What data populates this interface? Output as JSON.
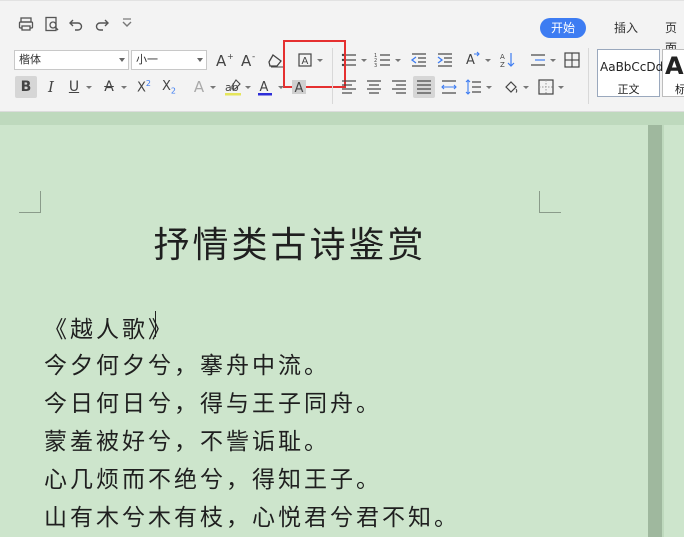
{
  "ribbon": {
    "tabs": [
      {
        "label": "开始",
        "active": true
      },
      {
        "label": "插入",
        "active": false
      },
      {
        "label": "页面"
      }
    ],
    "font_name": "楷体",
    "font_size": "小一",
    "styles": [
      {
        "sample": "AaBbCcDd",
        "name": "正文"
      },
      {
        "sample": "Aa",
        "name": "标"
      }
    ],
    "accent_color": "#3d7cf2",
    "highlight_border_color": "#e53030"
  },
  "document": {
    "title": "抒情类古诗鉴赏",
    "poem_title": "《越人歌》",
    "lines": [
      "今夕何夕兮，搴舟中流。",
      "今日何日兮，得与王子同舟。",
      "蒙羞被好兮，不訾诟耻。",
      "心几烦而不绝兮，得知王子。",
      "山有木兮木有枝，心悦君兮君不知。"
    ],
    "page_color": "#cde5cc"
  }
}
